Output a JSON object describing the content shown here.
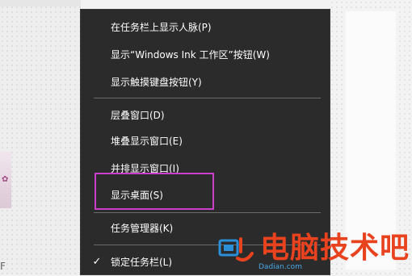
{
  "context_menu": {
    "items": [
      {
        "label": "在任务栏上显示人脉(P)"
      },
      {
        "label": "显示“Windows Ink 工作区”按钮(W)"
      },
      {
        "label": "显示触摸键盘按钮(Y)"
      },
      {
        "label": "层叠窗口(D)"
      },
      {
        "label": "堆叠显示窗口(E)"
      },
      {
        "label": "并排显示窗口(I)"
      },
      {
        "label": "显示桌面(S)",
        "highlighted": true
      },
      {
        "label": "任务管理器(K)"
      },
      {
        "label": "锁定任务栏(L)",
        "checked": true,
        "check_glyph": "✓"
      }
    ]
  },
  "desktop": {
    "edge_text": "F"
  },
  "watermark": {
    "text": "电脑技术吧",
    "sub": "Dadian.com",
    "color": "#e8421e"
  },
  "colors": {
    "menu_bg": "#2b2b2b",
    "highlight": "#c93fc9"
  }
}
